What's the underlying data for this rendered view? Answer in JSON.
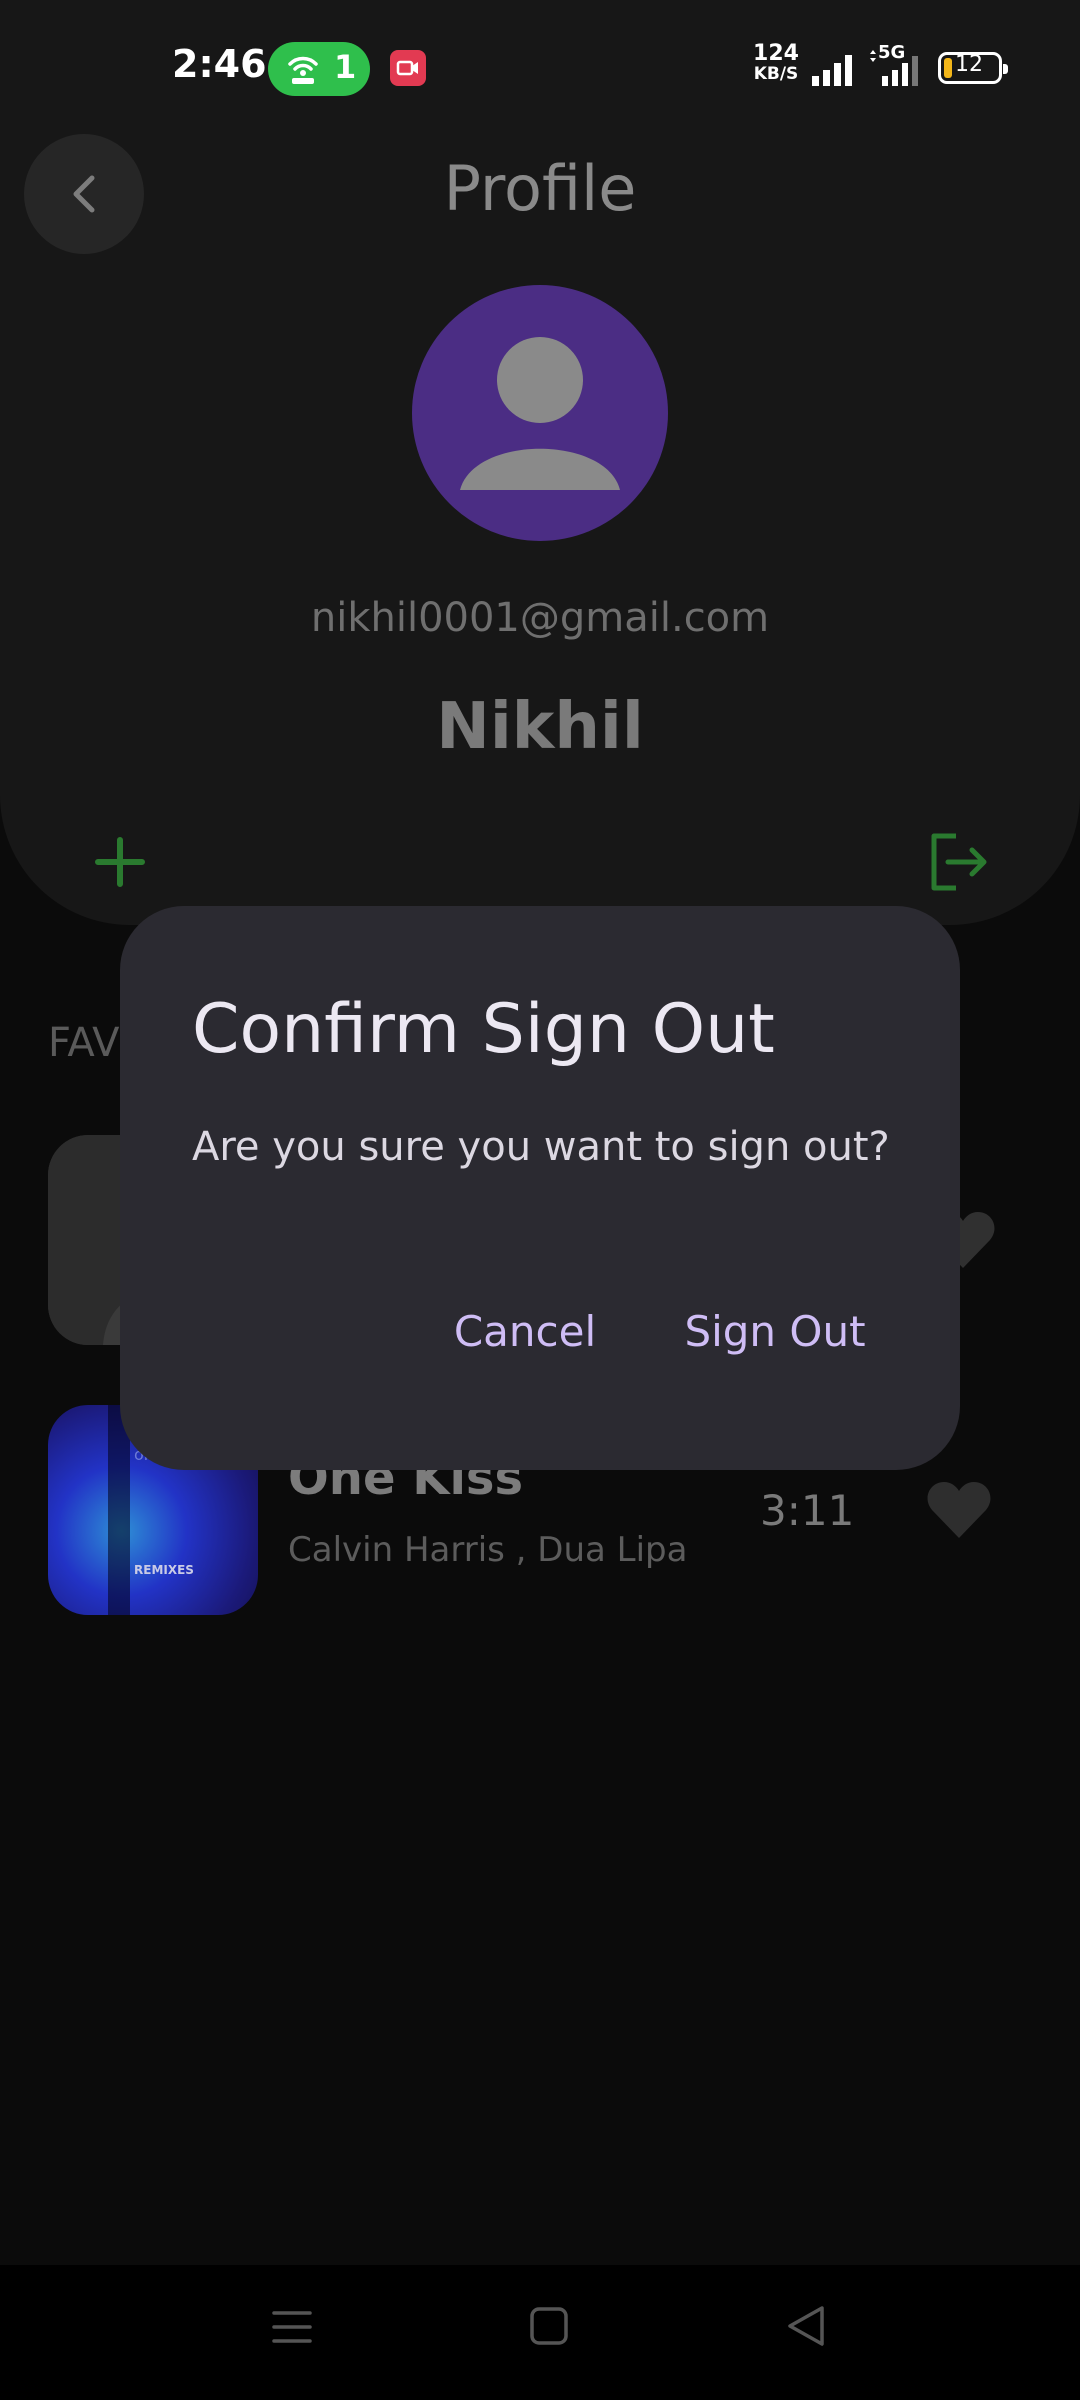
{
  "status_bar": {
    "time": "2:46",
    "hotspot_count": "1",
    "net_speed_value": "124",
    "net_speed_unit": "KB/S",
    "network_type": "5G",
    "battery_level": "12",
    "hotspot_color": "#2fbf4c",
    "record_color": "#e23a52",
    "battery_color": "#f3b619"
  },
  "header": {
    "title": "Profile",
    "back_icon": "chevron-left-icon"
  },
  "profile": {
    "email": "nikhil0001@gmail.com",
    "name": "Nikhil",
    "avatar_color": "#4b2d84",
    "add_icon": "plus-icon",
    "sign_out_icon": "logout-icon",
    "accent_color": "#2a7a2f"
  },
  "favorites": {
    "section_label": "FAV",
    "songs": [
      {
        "title": "",
        "artist": "",
        "duration": "",
        "liked": true
      },
      {
        "title": "One Kiss",
        "artist": "Calvin Harris , Dua Lipa",
        "duration": "3:11",
        "liked": true,
        "art_text_top": "one",
        "art_text_bottom": "REMIXES"
      }
    ]
  },
  "dialog": {
    "title": "Confirm Sign Out",
    "message": "Are you sure you want to sign out?",
    "cancel_label": "Cancel",
    "confirm_label": "Sign Out",
    "background": "#2b2a31",
    "button_color": "#cfbdf5"
  },
  "nav_bar": {
    "menu_icon": "menu-icon",
    "home_icon": "home-square-icon",
    "back_icon": "back-triangle-icon"
  }
}
